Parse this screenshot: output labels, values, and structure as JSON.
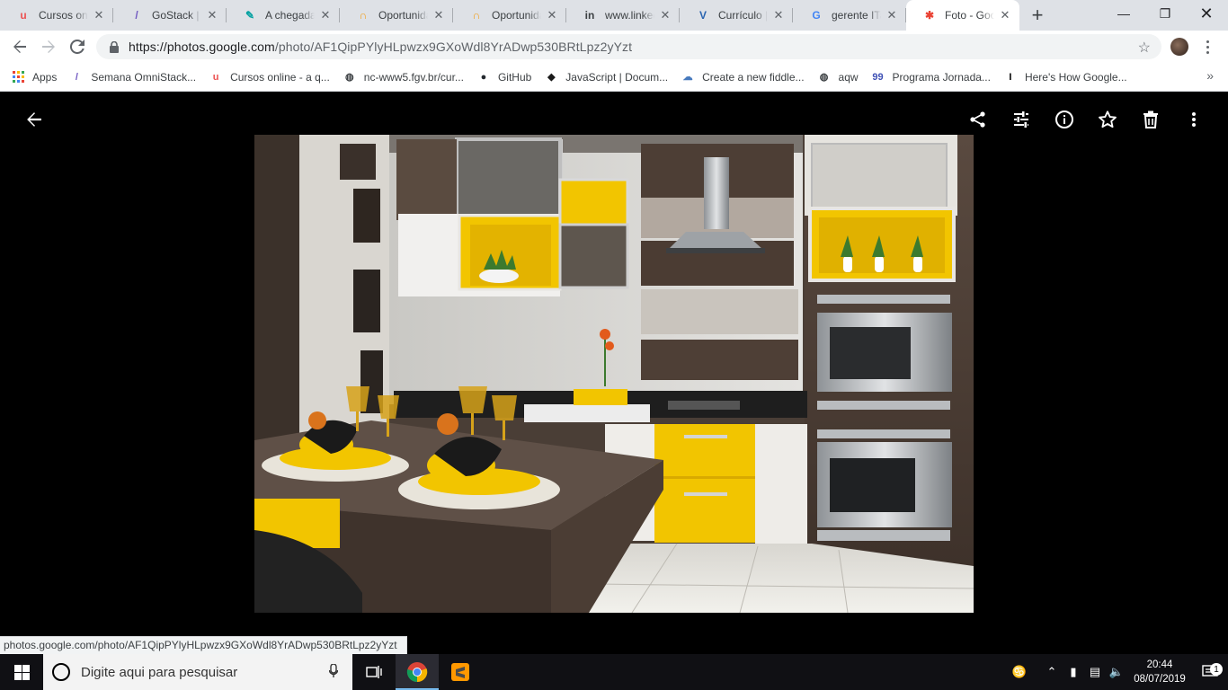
{
  "tabs": [
    {
      "title": "Cursos online",
      "favicon": "udemy-icon",
      "color": "#ec5252",
      "glyph": "u"
    },
    {
      "title": "GoStack | Bootcamp",
      "favicon": "rocketseat-icon",
      "color": "#7159c1",
      "glyph": "/"
    },
    {
      "title": "A chegada do",
      "favicon": "feather-icon",
      "color": "#00a0a0",
      "glyph": "✎"
    },
    {
      "title": "Oportunidades",
      "favicon": "gupy-icon",
      "color": "#f39c12",
      "glyph": "∩"
    },
    {
      "title": "Oportunidades",
      "favicon": "gupy-icon",
      "color": "#f39c12",
      "glyph": "∩"
    },
    {
      "title": "www.linkedin",
      "favicon": "linkedin-icon",
      "color": "#3c4043",
      "glyph": "in"
    },
    {
      "title": "Currículo | Vagas",
      "favicon": "vagas-icon",
      "color": "#2a64b0",
      "glyph": "V"
    },
    {
      "title": "gerente ITau",
      "favicon": "google-icon",
      "color": "#4285f4",
      "glyph": "G"
    },
    {
      "title": "Foto - Google Fotos",
      "favicon": "google-photos-icon",
      "color": "#ea4335",
      "glyph": "✱",
      "active": true
    }
  ],
  "url": {
    "host": "https://photos.google.com",
    "path": "/photo/AF1QipPYlyHLpwzx9GXoWdl8YrADwp530BRtLpz2yYzt"
  },
  "bookmarks": [
    {
      "label": "Apps",
      "icon": "apps-grid-icon"
    },
    {
      "label": "Semana OmniStack...",
      "icon": "rocketseat-icon",
      "color": "#7159c1",
      "glyph": "/"
    },
    {
      "label": "Cursos online - a q...",
      "icon": "udemy-icon",
      "color": "#ec5252",
      "glyph": "u"
    },
    {
      "label": "nc-www5.fgv.br/cur...",
      "icon": "globe-icon",
      "color": "#3c4043",
      "glyph": "◍"
    },
    {
      "label": "GitHub",
      "icon": "github-icon",
      "color": "#24292e",
      "glyph": "●"
    },
    {
      "label": "JavaScript | Docum...",
      "icon": "js-doc-icon",
      "color": "#1a1a1a",
      "glyph": "◆"
    },
    {
      "label": "Create a new fiddle...",
      "icon": "jsfiddle-icon",
      "color": "#4679bd",
      "glyph": "☁"
    },
    {
      "label": "aqw",
      "icon": "globe-icon",
      "color": "#3c4043",
      "glyph": "◍"
    },
    {
      "label": "Programa Jornada...",
      "icon": "99-icon",
      "color": "#3f51b5",
      "glyph": "99"
    },
    {
      "label": "Here's How Google...",
      "icon": "medium-icon",
      "color": "#000000",
      "glyph": "I"
    }
  ],
  "status_url": "photos.google.com/photo/AF1QipPYlyHLpwzx9GXoWdl8YrADwp530BRtLpz2yYzt",
  "taskbar": {
    "search_placeholder": "Digite aqui para pesquisar",
    "time": "20:44",
    "date": "08/07/2019",
    "notification_count": "1"
  },
  "colors": {
    "accent_yellow": "#f2c500",
    "viewer_bg": "#000000"
  }
}
